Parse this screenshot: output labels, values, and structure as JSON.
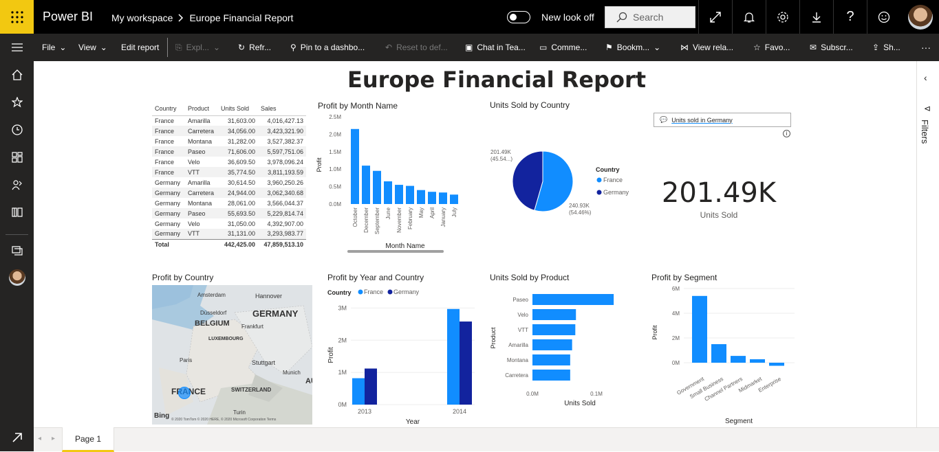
{
  "app": {
    "name": "Power BI",
    "breadcrumb": [
      "My workspace",
      "Europe Financial Report"
    ],
    "new_look": "New look off",
    "search_placeholder": "Search"
  },
  "toolbar": {
    "file": "File",
    "view": "View",
    "edit": "Edit report",
    "explore": "Expl...",
    "refresh": "Refr...",
    "pin": "Pin to a dashbo...",
    "reset": "Reset to def...",
    "chat": "Chat in Tea...",
    "comments": "Comme...",
    "bookmarks": "Bookm...",
    "view_related": "View rela...",
    "favorite": "Favo...",
    "subscribe": "Subscr...",
    "share": "Sh...",
    "more": "···"
  },
  "report": {
    "title": "Europe Financial Report"
  },
  "matrix": {
    "headers": [
      "Country",
      "Product",
      "Units Sold",
      "Sales"
    ],
    "rows": [
      [
        "France",
        "Amarilla",
        "31,603.00",
        "4,016,427.13"
      ],
      [
        "France",
        "Carretera",
        "34,056.00",
        "3,423,321.90"
      ],
      [
        "France",
        "Montana",
        "31,282.00",
        "3,527,382.37"
      ],
      [
        "France",
        "Paseo",
        "71,606.00",
        "5,597,751.06"
      ],
      [
        "France",
        "Velo",
        "36,609.50",
        "3,978,096.24"
      ],
      [
        "France",
        "VTT",
        "35,774.50",
        "3,811,193.59"
      ],
      [
        "Germany",
        "Amarilla",
        "30,614.50",
        "3,960,250.26"
      ],
      [
        "Germany",
        "Carretera",
        "24,944.00",
        "3,062,340.68"
      ],
      [
        "Germany",
        "Montana",
        "28,061.00",
        "3,566,044.37"
      ],
      [
        "Germany",
        "Paseo",
        "55,693.50",
        "5,229,814.74"
      ],
      [
        "Germany",
        "Velo",
        "31,050.00",
        "4,392,907.00"
      ],
      [
        "Germany",
        "VTT",
        "31,131.00",
        "3,293,983.77"
      ]
    ],
    "total": [
      "Total",
      "",
      "442,425.00",
      "47,859,513.10"
    ]
  },
  "chart_data": [
    {
      "type": "bar",
      "title": "Profit by Month Name",
      "xlabel": "Month Name",
      "ylabel": "Profit",
      "categories": [
        "October",
        "December",
        "September",
        "June",
        "November",
        "February",
        "May",
        "April",
        "January",
        "July"
      ],
      "values": [
        2.15,
        1.1,
        0.95,
        0.65,
        0.55,
        0.52,
        0.4,
        0.35,
        0.33,
        0.27
      ],
      "yticks": [
        "0.0M",
        "0.5M",
        "1.0M",
        "1.5M",
        "2.0M",
        "2.5M"
      ],
      "ylim": [
        0,
        2.5
      ],
      "color": "#118dff"
    },
    {
      "type": "pie",
      "title": "Units Sold by Country",
      "legend_title": "Country",
      "categories": [
        "France",
        "Germany"
      ],
      "values": [
        240.93,
        201.49
      ],
      "labels": [
        "240.93K\n(54.46%)",
        "201.49K\n(45.54...)"
      ],
      "colors": [
        "#118dff",
        "#12239e"
      ]
    },
    {
      "type": "bar",
      "title": "Profit by Year and Country",
      "legend_title": "Country",
      "xlabel": "Year",
      "ylabel": "Profit",
      "categories": [
        "2013",
        "2014"
      ],
      "series": [
        {
          "name": "France",
          "values": [
            0.82,
            2.97
          ],
          "color": "#118dff"
        },
        {
          "name": "Germany",
          "values": [
            1.12,
            2.58
          ],
          "color": "#12239e"
        }
      ],
      "yticks": [
        "0M",
        "1M",
        "2M",
        "3M"
      ],
      "ylim": [
        0,
        3.2
      ]
    },
    {
      "type": "bar",
      "orientation": "horizontal",
      "title": "Units Sold by Product",
      "xlabel": "Units Sold",
      "ylabel": "Product",
      "categories": [
        "Paseo",
        "Velo",
        "VTT",
        "Amarilla",
        "Montana",
        "Carretera"
      ],
      "values": [
        0.127,
        0.068,
        0.067,
        0.062,
        0.059,
        0.059
      ],
      "xticks": [
        "0.0M",
        "0.1M"
      ],
      "xlim": [
        0,
        0.1
      ],
      "color": "#118dff"
    },
    {
      "type": "bar",
      "title": "Profit by Segment",
      "xlabel": "Segment",
      "ylabel": "Profit",
      "categories": [
        "Government",
        "Small Business",
        "Channel Partners",
        "Midmarket",
        "Enterprise"
      ],
      "values": [
        5.4,
        1.5,
        0.55,
        0.28,
        -0.25
      ],
      "yticks": [
        "0M",
        "2M",
        "4M",
        "6M"
      ],
      "ylim": [
        -0.5,
        6
      ],
      "color": "#118dff"
    }
  ],
  "map": {
    "title": "Profit by Country",
    "labels": [
      "Amsterdam",
      "Hannover",
      "Düsseldorf",
      "GERMANY",
      "BELGIUM",
      "Frankfurt",
      "LUXEMBOURG",
      "Paris",
      "Stuttgart",
      "Munich",
      "FRANCE",
      "SWITZERLAND",
      "Turin",
      "AU"
    ],
    "credit": "© 2020 TomTom © 2020 HERE, © 2020 Microsoft Corporation Terms",
    "bing": "Bing"
  },
  "kpi": {
    "value": "201.49K",
    "label": "Units Sold",
    "qa_text": "Units sold in Germany"
  },
  "filters_label": "Filters",
  "page_tab": "Page 1"
}
